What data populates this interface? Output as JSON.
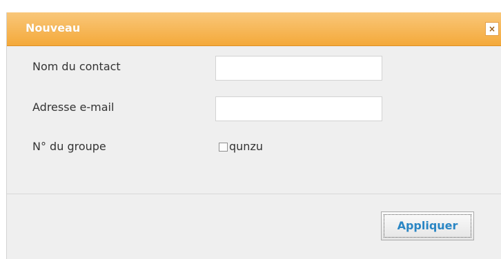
{
  "dialog": {
    "title": "Nouveau",
    "close_symbol": "×",
    "fields": {
      "contact_name_label": "Nom du contact",
      "contact_name_value": "",
      "email_label": "Adresse e-mail",
      "email_value": "",
      "group_label": "N° du groupe",
      "group_option_label": "qunzu",
      "group_option_checked": false
    },
    "apply_label": "Appliquer"
  },
  "colors": {
    "title_bar": "#f4a93a",
    "dialog_bg": "#efefef",
    "button_text": "#2a86c4"
  }
}
